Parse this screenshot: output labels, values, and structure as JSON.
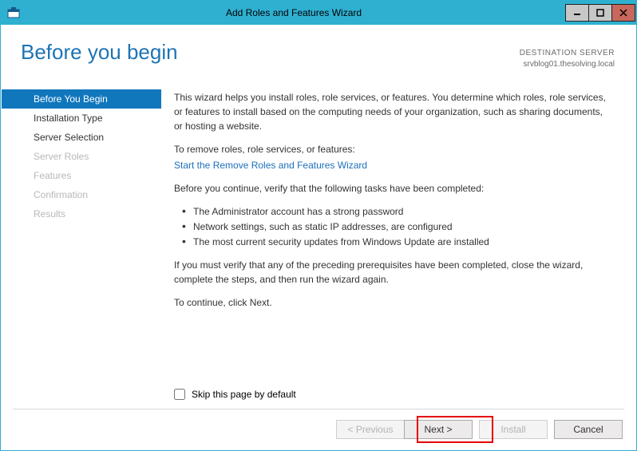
{
  "window": {
    "title": "Add Roles and Features Wizard"
  },
  "header": {
    "page_title": "Before you begin",
    "destination_label": "DESTINATION SERVER",
    "destination_server": "srvblog01.thesolving.local"
  },
  "sidebar": {
    "steps": [
      {
        "label": "Before You Begin",
        "state": "active"
      },
      {
        "label": "Installation Type",
        "state": "link"
      },
      {
        "label": "Server Selection",
        "state": "link"
      },
      {
        "label": "Server Roles",
        "state": "disabled"
      },
      {
        "label": "Features",
        "state": "disabled"
      },
      {
        "label": "Confirmation",
        "state": "disabled"
      },
      {
        "label": "Results",
        "state": "disabled"
      }
    ]
  },
  "main": {
    "intro": "This wizard helps you install roles, role services, or features. You determine which roles, role services, or features to install based on the computing needs of your organization, such as sharing documents, or hosting a website.",
    "remove_label": "To remove roles, role services, or features:",
    "remove_link": "Start the Remove Roles and Features Wizard",
    "verify_label": "Before you continue, verify that the following tasks have been completed:",
    "bullets": [
      "The Administrator account has a strong password",
      "Network settings, such as static IP addresses, are configured",
      "The most current security updates from Windows Update are installed"
    ],
    "verify_note": "If you must verify that any of the preceding prerequisites have been completed, close the wizard, complete the steps, and then run the wizard again.",
    "continue_note": "To continue, click Next.",
    "skip_label": "Skip this page by default"
  },
  "footer": {
    "previous": "< Previous",
    "next": "Next >",
    "install": "Install",
    "cancel": "Cancel"
  }
}
